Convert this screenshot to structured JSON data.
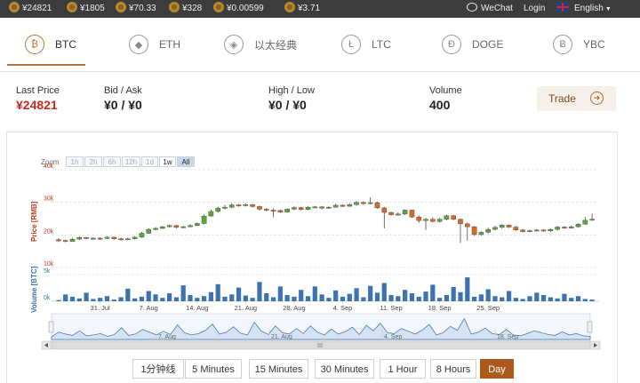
{
  "ticker": [
    {
      "price": "¥24821"
    },
    {
      "price": "¥1805"
    },
    {
      "price": "¥70.33"
    },
    {
      "price": "¥328"
    },
    {
      "price": "¥0.00599"
    },
    {
      "price": "¥3.71"
    }
  ],
  "header": {
    "wechat": "WeChat",
    "login": "Login",
    "language": "English"
  },
  "tabs": [
    {
      "label": "BTC",
      "icon": "bitcoin-icon",
      "glyph": "₿"
    },
    {
      "label": "ETH",
      "icon": "ethereum-icon",
      "glyph": "◆"
    },
    {
      "label": "以太经典",
      "icon": "ethereum-classic-icon",
      "glyph": "◈"
    },
    {
      "label": "LTC",
      "icon": "litecoin-icon",
      "glyph": "Ł"
    },
    {
      "label": "DOGE",
      "icon": "dogecoin-icon",
      "glyph": "Ð"
    },
    {
      "label": "YBC",
      "icon": "ybc-icon",
      "glyph": "Ƀ"
    }
  ],
  "stats": {
    "last_price_label": "Last Price",
    "last_price": "¥24821",
    "bid_ask_label": "Bid / Ask",
    "bid_ask": "¥0 / ¥0",
    "high_low_label": "High / Low",
    "high_low": "¥0 / ¥0",
    "volume_label": "Volume",
    "volume": "400",
    "trade_label": "Trade"
  },
  "colors": {
    "accent": "#b8743c",
    "up": "#5ea43e",
    "down": "#d8692a",
    "volume": "#3b73b0",
    "price_red": "#c42a1f"
  },
  "chart": {
    "zoom_label": "Zoom",
    "zoom_buttons": [
      "1h",
      "2h",
      "6h",
      "12h",
      "1d",
      "1w",
      "All"
    ],
    "zoom_selected": "All",
    "price_axis_label": "Price [RMB]",
    "volume_axis_label": "Volume [BTC]"
  },
  "intervals": [
    "1分钟线",
    "5 Minutes",
    "15 Minutes",
    "30 Minutes",
    "1 Hour",
    "8 Hours",
    "Day"
  ],
  "interval_active": "Day",
  "chart_data": {
    "type": "candlestick",
    "price_axis": {
      "ylim": [
        10000,
        40000
      ],
      "ticks": [
        "10k",
        "20k",
        "30k",
        "40k"
      ]
    },
    "volume_axis": {
      "ticks": [
        "0k",
        "5k"
      ]
    },
    "x_ticks": [
      "31. Jul",
      "7. Aug",
      "14. Aug",
      "21. Aug",
      "28. Aug",
      "4. Sep",
      "11. Sep",
      "18. Sep",
      "25. Sep"
    ],
    "navigator_ticks": [
      "7. Aug",
      "21. Aug",
      "4. Sep",
      "18. Sep"
    ],
    "candles": [
      [
        18500,
        18300,
        19000,
        17800
      ],
      [
        18300,
        18000,
        18600,
        17700
      ],
      [
        18000,
        18700,
        19100,
        17900
      ],
      [
        18700,
        19200,
        19500,
        18500
      ],
      [
        19200,
        18900,
        19400,
        18600
      ],
      [
        18900,
        19000,
        19300,
        18700
      ],
      [
        19000,
        18900,
        19300,
        18500
      ],
      [
        18900,
        19300,
        19600,
        18700
      ],
      [
        19300,
        18800,
        19400,
        18500
      ],
      [
        18800,
        18600,
        19100,
        18200
      ],
      [
        18600,
        18800,
        19100,
        18400
      ],
      [
        18800,
        19300,
        19600,
        18600
      ],
      [
        19300,
        20500,
        20900,
        19100
      ],
      [
        20500,
        21700,
        22000,
        20300
      ],
      [
        21700,
        22000,
        22400,
        21400
      ],
      [
        22000,
        22500,
        22800,
        21800
      ],
      [
        22500,
        22900,
        23200,
        22300
      ],
      [
        22900,
        22300,
        23100,
        22000
      ],
      [
        22300,
        22500,
        22800,
        22100
      ],
      [
        22500,
        22900,
        23300,
        22300
      ],
      [
        22900,
        23500,
        23800,
        22700
      ],
      [
        23500,
        25800,
        26300,
        23300
      ],
      [
        25800,
        27200,
        27800,
        25500
      ],
      [
        27200,
        28200,
        28700,
        26900
      ],
      [
        28200,
        28500,
        29200,
        27800
      ],
      [
        28500,
        29200,
        29700,
        28200
      ],
      [
        29200,
        29000,
        29500,
        28600
      ],
      [
        29000,
        29300,
        29700,
        28700
      ],
      [
        29300,
        28700,
        29500,
        28400
      ],
      [
        28700,
        27900,
        29000,
        27400
      ],
      [
        27900,
        27600,
        28200,
        27200
      ],
      [
        27600,
        27500,
        28100,
        25400
      ],
      [
        27500,
        27000,
        27800,
        26700
      ],
      [
        27000,
        27900,
        28200,
        26800
      ],
      [
        27900,
        28400,
        28800,
        27600
      ],
      [
        28400,
        27800,
        28600,
        27500
      ],
      [
        27800,
        28500,
        28900,
        27600
      ],
      [
        28500,
        28600,
        28900,
        28300
      ],
      [
        28600,
        28200,
        28900,
        27900
      ],
      [
        28200,
        28500,
        28800,
        28000
      ],
      [
        28500,
        29100,
        29500,
        28300
      ],
      [
        29100,
        28800,
        29400,
        28500
      ],
      [
        28800,
        29300,
        29700,
        28600
      ],
      [
        29300,
        30000,
        30400,
        29000
      ],
      [
        30000,
        29600,
        30300,
        29300
      ],
      [
        29600,
        29900,
        31500,
        29400
      ],
      [
        29900,
        28300,
        30200,
        28000
      ],
      [
        28300,
        26900,
        28600,
        22000
      ],
      [
        26900,
        26200,
        27100,
        25900
      ],
      [
        26200,
        26400,
        26900,
        25900
      ],
      [
        26400,
        27600,
        27800,
        26100
      ],
      [
        27600,
        25500,
        27800,
        25200
      ],
      [
        25500,
        24400,
        26000,
        23700
      ],
      [
        24400,
        24800,
        25200,
        21500
      ],
      [
        24800,
        24100,
        25400,
        23800
      ],
      [
        24100,
        24800,
        25200,
        23800
      ],
      [
        24800,
        25900,
        26200,
        24500
      ],
      [
        25900,
        24800,
        26100,
        24500
      ],
      [
        24800,
        23400,
        25000,
        17500
      ],
      [
        23400,
        22500,
        23800,
        18300
      ],
      [
        22500,
        20100,
        22700,
        19800
      ],
      [
        20100,
        20800,
        21100,
        19800
      ],
      [
        20800,
        21700,
        22200,
        20500
      ],
      [
        21700,
        22300,
        22800,
        21400
      ],
      [
        22300,
        23000,
        23300,
        21900
      ],
      [
        23000,
        22400,
        23200,
        22100
      ],
      [
        22400,
        21500,
        22700,
        21200
      ],
      [
        21500,
        21000,
        21800,
        20800
      ],
      [
        21000,
        21300,
        21600,
        20800
      ],
      [
        21300,
        21500,
        21800,
        21100
      ],
      [
        21500,
        21200,
        21800,
        21000
      ],
      [
        21200,
        21700,
        22000,
        21000
      ],
      [
        21700,
        22400,
        22700,
        21400
      ],
      [
        22400,
        22100,
        22700,
        21800
      ],
      [
        22100,
        22500,
        22900,
        21900
      ],
      [
        22500,
        23300,
        23600,
        22300
      ],
      [
        23300,
        24500,
        25500,
        23100
      ],
      [
        24500,
        24821,
        26500,
        24300
      ]
    ],
    "volumes": [
      200,
      1200,
      800,
      500,
      1500,
      400,
      600,
      900,
      300,
      700,
      2200,
      500,
      800,
      1800,
      1200,
      600,
      1400,
      700,
      2800,
      1100,
      600,
      900,
      1600,
      3000,
      800,
      1200,
      2400,
      1000,
      600,
      3400,
      1400,
      700,
      2600,
      1100,
      800,
      2000,
      900,
      2600,
      1200,
      600,
      1900,
      800,
      1300,
      2300,
      700,
      2700,
      1500,
      3200,
      1100,
      900,
      2000,
      1400,
      800,
      1700,
      2900,
      600,
      1100,
      2500,
      1600,
      4200,
      800,
      1200,
      2100,
      900,
      700,
      1800,
      600,
      400,
      900,
      1500,
      1100,
      700,
      500,
      1300,
      600,
      900,
      400,
      300
    ]
  }
}
